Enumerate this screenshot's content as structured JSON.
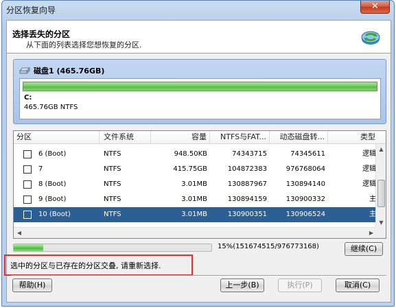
{
  "window": {
    "title": "分区恢复向导",
    "close_label": "✕"
  },
  "header": {
    "title": "选择丢失的分区",
    "subtitle": "从下面的列表选择您想恢复的分区."
  },
  "disk": {
    "label": "磁盘1 (465.76GB)",
    "partition_letter": "C:",
    "partition_info": "465.76GB NTFS",
    "bar_color": "#6fca5c"
  },
  "table": {
    "headers": [
      "分区",
      "文件系统",
      "容量",
      "NTFS与FAT...",
      "动态磁盘转...",
      "类型"
    ],
    "rows": [
      {
        "name": "6 (Boot)",
        "fs": "NTFS",
        "size": "948.50KB",
        "start": "74343715",
        "end": "74345611",
        "type": "逻辑",
        "selected": false
      },
      {
        "name": "7",
        "fs": "NTFS",
        "size": "415.75GB",
        "start": "104872383",
        "end": "976768064",
        "type": "逻辑",
        "selected": false
      },
      {
        "name": "8 (Boot)",
        "fs": "NTFS",
        "size": "3.01MB",
        "start": "130887967",
        "end": "130894140",
        "type": "逻辑",
        "selected": false
      },
      {
        "name": "9 (Boot)",
        "fs": "NTFS",
        "size": "3.01MB",
        "start": "130894159",
        "end": "130900332",
        "type": "主",
        "selected": false
      },
      {
        "name": "10 (Boot)",
        "fs": "NTFS",
        "size": "3.01MB",
        "start": "130900351",
        "end": "130906524",
        "type": "主",
        "selected": true
      }
    ]
  },
  "progress": {
    "percent": 15,
    "text": "15%(151674515/976773168)",
    "continue_label": "继续(C)"
  },
  "message": "选中的分区与已存在的分区交叠, 请重新选择.",
  "buttons": {
    "help": "帮助(H)",
    "back": "上一步(B)",
    "execute": "执行(P)",
    "cancel": "取消(C)"
  },
  "colors": {
    "selection": "#2c5f93",
    "highlight_border": "#e5302a",
    "progress_fill": "#44bb34"
  }
}
